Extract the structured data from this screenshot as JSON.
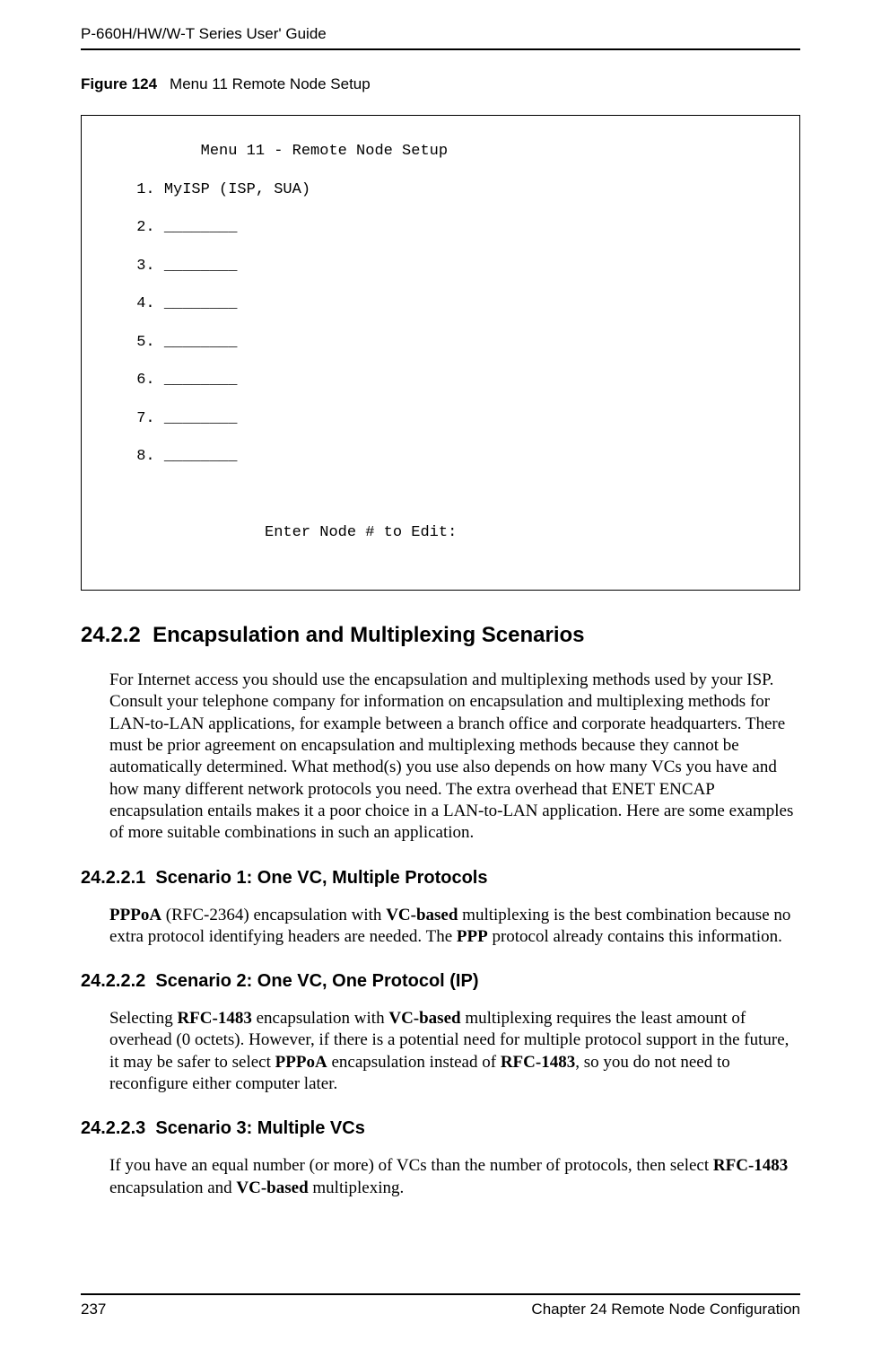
{
  "header": {
    "running_head": "P-660H/HW/W-T Series User' Guide"
  },
  "figure": {
    "label": "Figure 124",
    "title": "Menu 11 Remote Node Setup"
  },
  "terminal": {
    "title_line": "             Menu 11 - Remote Node Setup",
    "line1": "      1. MyISP (ISP, SUA)",
    "line2": "      2. ________",
    "line3": "      3. ________",
    "line4": "      4. ________",
    "line5": "      5. ________",
    "line6": "      6. ________",
    "line7": "      7. ________",
    "line8": "      8. ________",
    "prompt_line": "                    Enter Node # to Edit:"
  },
  "sections": {
    "s1_num": "24.2.2",
    "s1_title": "Encapsulation and Multiplexing Scenarios",
    "s1_p1a": "For Internet access you should use the encapsulation and multiplexing methods used by your ISP. Consult your telephone company for information on encapsulation and multiplexing methods for LAN-to-LAN applications, for example between a branch office and corporate headquarters. There must be prior agreement on encapsulation and multiplexing methods because they cannot be automatically determined. What method(s) you use also depends on how many VCs you have and how many different network protocols you need. The extra overhead that ENET ENCAP encapsulation entails makes it a poor choice in a LAN-to-LAN application. Here are some examples of more suitable combinations in such an application.",
    "s2_num": "24.2.2.1",
    "s2_title": "Scenario 1: One VC, Multiple Protocols",
    "s2_b1": "PPPoA",
    "s2_t1": " (RFC-2364) encapsulation with ",
    "s2_b2": "VC-based",
    "s2_t2": " multiplexing is the best combination because no extra protocol identifying headers are needed. The ",
    "s2_b3": "PPP",
    "s2_t3": " protocol already contains this information.",
    "s3_num": "24.2.2.2",
    "s3_title": "Scenario 2: One VC, One Protocol (IP)",
    "s3_t0": "Selecting ",
    "s3_b1": "RFC-1483",
    "s3_t1": " encapsulation with ",
    "s3_b2": "VC-based",
    "s3_t2": " multiplexing requires the least amount of overhead (0 octets). However, if there is a potential need for multiple protocol support in the future, it may be safer to select ",
    "s3_b3": "PPPoA",
    "s3_t3": " encapsulation instead of ",
    "s3_b4": "RFC-1483",
    "s3_t4": ", so you do not need to reconfigure either computer later.",
    "s4_num": "24.2.2.3",
    "s4_title": "Scenario 3: Multiple VCs",
    "s4_t0": "If you have an equal number (or more) of VCs than the number of protocols, then select ",
    "s4_b1": "RFC-1483",
    "s4_t1": " encapsulation and ",
    "s4_b2": "VC-based",
    "s4_t2": " multiplexing."
  },
  "footer": {
    "page_number": "237",
    "chapter": "Chapter 24 Remote Node Configuration"
  }
}
